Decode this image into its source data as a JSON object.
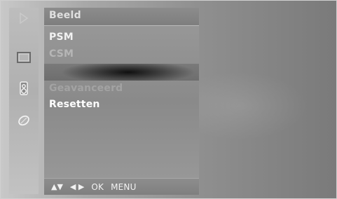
{
  "menu": {
    "title": "Beeld",
    "items": [
      {
        "label": "PSM"
      },
      {
        "label": "CSM"
      },
      {
        "label": "Geavanceerd"
      },
      {
        "label": "Resetten"
      }
    ]
  },
  "footer": {
    "up_down": "▲▼",
    "left_right": "◀ ▶",
    "ok": "OK",
    "menu": "MENU"
  },
  "icons": {
    "rail": [
      "nav-icon",
      "picture-icon",
      "sound-icon",
      "option-icon"
    ]
  }
}
